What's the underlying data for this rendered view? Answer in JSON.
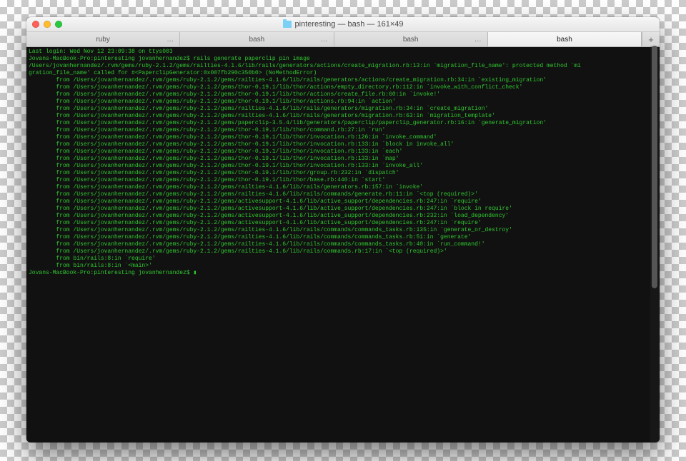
{
  "window": {
    "title": "pinteresting — bash — 161×49"
  },
  "tabs": [
    {
      "label": "ruby",
      "ellipsis": "…"
    },
    {
      "label": "bash",
      "ellipsis": "…"
    },
    {
      "label": "bash",
      "ellipsis": "…"
    },
    {
      "label": "bash",
      "ellipsis": ""
    }
  ],
  "add_tab": "+",
  "terminal": {
    "last_login": "Last login: Wed Nov 12 23:09:38 on ttys003",
    "prompt1": "Jovans-MacBook-Pro:pinteresting jovanhernandez$ ",
    "command": "rails generate paperclip pin image",
    "error_head": "/Users/jovanhernandez/.rvm/gems/ruby-2.1.2/gems/railties-4.1.6/lib/rails/generators/actions/create_migration.rb:13:in `migration_file_name': protected method `mi",
    "error_head2": "gration_file_name' called for #<PaperclipGenerator:0x007fb290c350b0> (NoMethodError)",
    "traces": [
      "from /Users/jovanhernandez/.rvm/gems/ruby-2.1.2/gems/railties-4.1.6/lib/rails/generators/actions/create_migration.rb:34:in `existing_migration'",
      "from /Users/jovanhernandez/.rvm/gems/ruby-2.1.2/gems/thor-0.19.1/lib/thor/actions/empty_directory.rb:112:in `invoke_with_conflict_check'",
      "from /Users/jovanhernandez/.rvm/gems/ruby-2.1.2/gems/thor-0.19.1/lib/thor/actions/create_file.rb:60:in `invoke!'",
      "from /Users/jovanhernandez/.rvm/gems/ruby-2.1.2/gems/thor-0.19.1/lib/thor/actions.rb:94:in `action'",
      "from /Users/jovanhernandez/.rvm/gems/ruby-2.1.2/gems/railties-4.1.6/lib/rails/generators/migration.rb:34:in `create_migration'",
      "from /Users/jovanhernandez/.rvm/gems/ruby-2.1.2/gems/railties-4.1.6/lib/rails/generators/migration.rb:63:in `migration_template'",
      "from /Users/jovanhernandez/.rvm/gems/ruby-2.1.2/gems/paperclip-3.5.4/lib/generators/paperclip/paperclip_generator.rb:16:in `generate_migration'",
      "from /Users/jovanhernandez/.rvm/gems/ruby-2.1.2/gems/thor-0.19.1/lib/thor/command.rb:27:in `run'",
      "from /Users/jovanhernandez/.rvm/gems/ruby-2.1.2/gems/thor-0.19.1/lib/thor/invocation.rb:126:in `invoke_command'",
      "from /Users/jovanhernandez/.rvm/gems/ruby-2.1.2/gems/thor-0.19.1/lib/thor/invocation.rb:133:in `block in invoke_all'",
      "from /Users/jovanhernandez/.rvm/gems/ruby-2.1.2/gems/thor-0.19.1/lib/thor/invocation.rb:133:in `each'",
      "from /Users/jovanhernandez/.rvm/gems/ruby-2.1.2/gems/thor-0.19.1/lib/thor/invocation.rb:133:in `map'",
      "from /Users/jovanhernandez/.rvm/gems/ruby-2.1.2/gems/thor-0.19.1/lib/thor/invocation.rb:133:in `invoke_all'",
      "from /Users/jovanhernandez/.rvm/gems/ruby-2.1.2/gems/thor-0.19.1/lib/thor/group.rb:232:in `dispatch'",
      "from /Users/jovanhernandez/.rvm/gems/ruby-2.1.2/gems/thor-0.19.1/lib/thor/base.rb:440:in `start'",
      "from /Users/jovanhernandez/.rvm/gems/ruby-2.1.2/gems/railties-4.1.6/lib/rails/generators.rb:157:in `invoke'",
      "from /Users/jovanhernandez/.rvm/gems/ruby-2.1.2/gems/railties-4.1.6/lib/rails/commands/generate.rb:11:in `<top (required)>'",
      "from /Users/jovanhernandez/.rvm/gems/ruby-2.1.2/gems/activesupport-4.1.6/lib/active_support/dependencies.rb:247:in `require'",
      "from /Users/jovanhernandez/.rvm/gems/ruby-2.1.2/gems/activesupport-4.1.6/lib/active_support/dependencies.rb:247:in `block in require'",
      "from /Users/jovanhernandez/.rvm/gems/ruby-2.1.2/gems/activesupport-4.1.6/lib/active_support/dependencies.rb:232:in `load_dependency'",
      "from /Users/jovanhernandez/.rvm/gems/ruby-2.1.2/gems/activesupport-4.1.6/lib/active_support/dependencies.rb:247:in `require'",
      "from /Users/jovanhernandez/.rvm/gems/ruby-2.1.2/gems/railties-4.1.6/lib/rails/commands/commands_tasks.rb:135:in `generate_or_destroy'",
      "from /Users/jovanhernandez/.rvm/gems/ruby-2.1.2/gems/railties-4.1.6/lib/rails/commands/commands_tasks.rb:51:in `generate'",
      "from /Users/jovanhernandez/.rvm/gems/ruby-2.1.2/gems/railties-4.1.6/lib/rails/commands/commands_tasks.rb:40:in `run_command!'",
      "from /Users/jovanhernandez/.rvm/gems/ruby-2.1.2/gems/railties-4.1.6/lib/rails/commands.rb:17:in `<top (required)>'",
      "from bin/rails:8:in `require'",
      "from bin/rails:8:in `<main>'"
    ],
    "prompt2": "Jovans-MacBook-Pro:pinteresting jovanhernandez$ ",
    "cursor": "▮"
  }
}
